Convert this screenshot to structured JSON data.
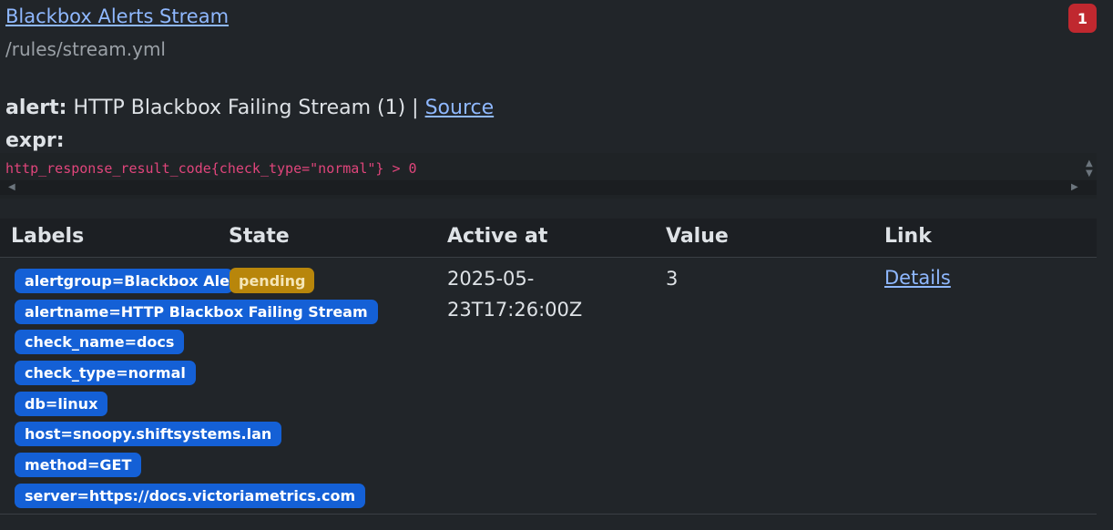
{
  "group": {
    "title": "Blackbox Alerts Stream",
    "file": "/rules/stream.yml",
    "alert_count": "1"
  },
  "rule": {
    "alert_label": "alert:",
    "alert_name": "HTTP Blackbox Failing Stream (1)",
    "separator": "|",
    "source_label": "Source",
    "expr_label": "expr:",
    "expr": "http_response_result_code{check_type=\"normal\"} > 0"
  },
  "table": {
    "headers": [
      "Labels",
      "State",
      "Active at",
      "Value",
      "Link"
    ],
    "row": {
      "labels": [
        "alertgroup=Blackbox Alerts Stream",
        "alertname=HTTP Blackbox Failing Stream",
        "check_name=docs",
        "check_type=normal",
        "db=linux",
        "host=snoopy.shiftsystems.lan",
        "method=GET",
        "server=https://docs.victoriametrics.com"
      ],
      "state": "pending",
      "active_at": "2025-05-23T17:26:00Z",
      "active_at_line1": "2025-05-",
      "active_at_line2": "23T17:26:00Z",
      "value": "3",
      "link": "Details"
    }
  },
  "colors": {
    "background": "#212529",
    "label_badge": "#1460d6",
    "state_pending": "#b8860b",
    "count_badge": "#c0282f",
    "link": "#8fb8ff",
    "expr": "#e0457b"
  }
}
